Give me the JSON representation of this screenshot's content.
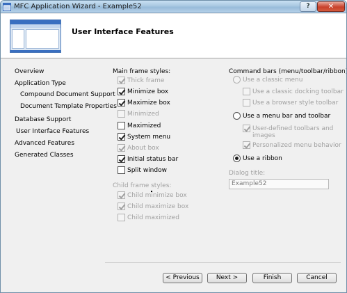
{
  "window": {
    "title": "MFC Application Wizard - Example52"
  },
  "titlebar": {
    "help_label": "?",
    "close_label": "✕"
  },
  "banner": {
    "heading": "User Interface Features"
  },
  "nav": {
    "items": [
      {
        "label": "Overview"
      },
      {
        "label": "Application Type"
      },
      {
        "label": "Compound Document Support"
      },
      {
        "label": "Document Template Properties"
      },
      {
        "label": "Database Support"
      },
      {
        "label": "User Interface Features"
      },
      {
        "label": "Advanced Features"
      },
      {
        "label": "Generated Classes"
      }
    ]
  },
  "main_frame": {
    "label": "Main frame styles:",
    "options": [
      {
        "label": "Thick frame",
        "checked": true,
        "enabled": false
      },
      {
        "label": "Minimize box",
        "checked": true,
        "enabled": true
      },
      {
        "label": "Maximize box",
        "checked": true,
        "enabled": true
      },
      {
        "label": "Minimized",
        "checked": false,
        "enabled": false
      },
      {
        "label": "Maximized",
        "checked": false,
        "enabled": true
      },
      {
        "label": "System menu",
        "checked": true,
        "enabled": true
      },
      {
        "label": "About box",
        "checked": true,
        "enabled": false
      },
      {
        "label": "Initial status bar",
        "checked": true,
        "enabled": true
      },
      {
        "label": "Split window",
        "checked": false,
        "enabled": true
      }
    ]
  },
  "child_frame": {
    "label": "Child frame styles:",
    "options": [
      {
        "label": "Child minimize box",
        "checked": true,
        "enabled": false
      },
      {
        "label": "Child maximize box",
        "checked": true,
        "enabled": false
      },
      {
        "label": "Child maximized",
        "checked": false,
        "enabled": false
      }
    ]
  },
  "command_bars": {
    "label": "Command bars (menu/toolbar/ribbon):",
    "classic_menu": {
      "label": "Use a classic menu",
      "selected": false,
      "enabled": false
    },
    "classic_docking_toolbar": {
      "label": "Use a classic docking toolbar",
      "checked": false,
      "enabled": false
    },
    "browser_style_toolbar": {
      "label": "Use a browser style toolbar",
      "checked": false,
      "enabled": false
    },
    "menu_bar_toolbar": {
      "label": "Use a menu bar and toolbar",
      "selected": false,
      "enabled": true
    },
    "user_defined_line1": "User-defined toolbars and",
    "user_defined_line2": "images",
    "user_defined_checked": true,
    "personalized_menu": {
      "label": "Personalized menu behavior",
      "checked": true,
      "enabled": false
    },
    "ribbon": {
      "label": "Use a ribbon",
      "selected": true,
      "enabled": true
    }
  },
  "dialog_title": {
    "label": "Dialog title:",
    "value": "Example52"
  },
  "buttons": {
    "previous": "< Previous",
    "next": "Next >",
    "finish": "Finish",
    "cancel": "Cancel"
  }
}
